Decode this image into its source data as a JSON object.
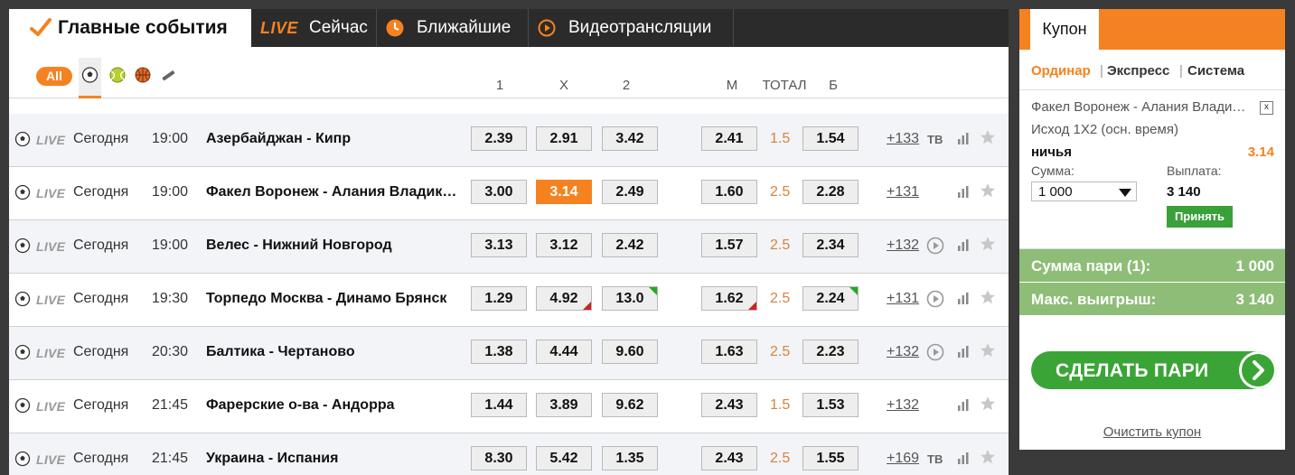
{
  "tabs": {
    "main_label": "Главные события",
    "live_logo": "LIVE",
    "now_label": "Сейчас",
    "nearest_label": "Ближайшие",
    "video_label": "Видеотрансляции"
  },
  "filter": {
    "all_label": "All",
    "sports": [
      "football-icon",
      "tennis-icon",
      "basketball-icon",
      "hockey-icon"
    ]
  },
  "columns": {
    "c1": "1",
    "cx": "X",
    "c2": "2",
    "m": "М",
    "total": "ТОТАЛ",
    "b": "Б"
  },
  "rows": [
    {
      "live": "LIVE",
      "day": "Сегодня",
      "time": "19:00",
      "match": "Азербайджан - Кипр",
      "o1": "2.39",
      "ox": "2.91",
      "o2": "3.42",
      "m": "2.41",
      "total": "1.5",
      "b": "1.54",
      "more": "+133",
      "tv": "ТВ"
    },
    {
      "live": "LIVE",
      "day": "Сегодня",
      "time": "19:00",
      "match": "Факел Воронеж - Алания Владикавказ",
      "o1": "3.00",
      "ox": "3.14",
      "o2": "2.49",
      "m": "1.60",
      "total": "2.5",
      "b": "2.28",
      "more": "+131"
    },
    {
      "live": "LIVE",
      "day": "Сегодня",
      "time": "19:00",
      "match": "Велес - Нижний Новгород",
      "o1": "3.13",
      "ox": "3.12",
      "o2": "2.42",
      "m": "1.57",
      "total": "2.5",
      "b": "2.34",
      "more": "+132"
    },
    {
      "live": "LIVE",
      "day": "Сегодня",
      "time": "19:30",
      "match": "Торпедо Москва - Динамо Брянск",
      "o1": "1.29",
      "ox": "4.92",
      "o2": "13.0",
      "m": "1.62",
      "total": "2.5",
      "b": "2.24",
      "more": "+131"
    },
    {
      "live": "LIVE",
      "day": "Сегодня",
      "time": "20:30",
      "match": "Балтика - Чертаново",
      "o1": "1.38",
      "ox": "4.44",
      "o2": "9.60",
      "m": "1.63",
      "total": "2.5",
      "b": "2.23",
      "more": "+132"
    },
    {
      "live": "LIVE",
      "day": "Сегодня",
      "time": "21:45",
      "match": "Фарерские о-ва - Андорра",
      "o1": "1.44",
      "ox": "3.89",
      "o2": "9.62",
      "m": "2.43",
      "total": "1.5",
      "b": "1.53",
      "more": "+132"
    },
    {
      "live": "LIVE",
      "day": "Сегодня",
      "time": "21:45",
      "match": "Украина - Испания",
      "o1": "8.30",
      "ox": "5.42",
      "o2": "1.35",
      "m": "2.43",
      "total": "2.5",
      "b": "1.55",
      "more": "+169",
      "tv": "ТВ"
    }
  ],
  "coupon": {
    "title": "Купон",
    "types": [
      "Ординар",
      "Экспресс",
      "Система"
    ],
    "event": "Факел Воронеж - Алания Владикавказ",
    "market": "Исход 1Х2 (осн. время)",
    "outcome": "ничья",
    "odd": "3.14",
    "sum_label": "Сумма:",
    "sum_value": "1 000",
    "payout_label": "Выплата:",
    "payout_value": "3 140",
    "accept": "Принять",
    "total_label": "Сумма пари (1):",
    "total_value": "1 000",
    "max_label": "Макс. выигрыш:",
    "max_value": "3 140",
    "bet_button": "СДЕЛАТЬ ПАРИ",
    "clear": "Очистить купон"
  },
  "colors": {
    "accent": "#f58220",
    "green": "#3aa536",
    "light_green": "#8ebd77",
    "total_text": "#d9823b"
  }
}
